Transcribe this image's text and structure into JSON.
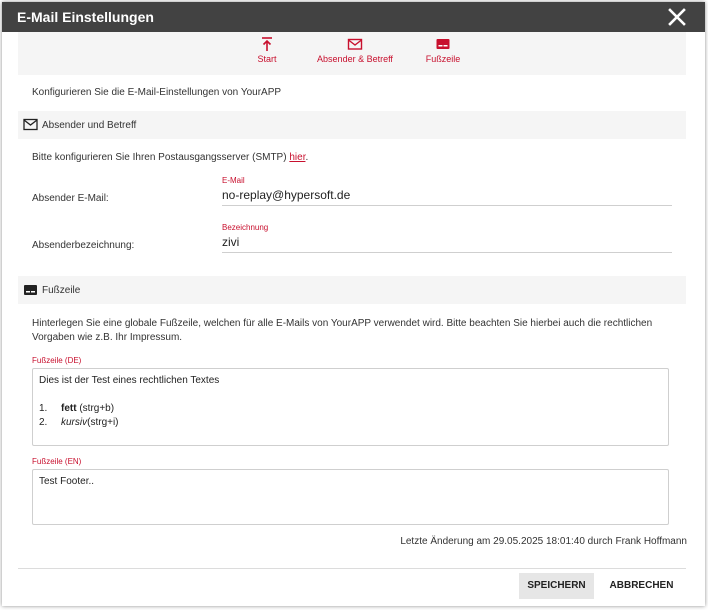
{
  "dialog": {
    "title": "E-Mail Einstellungen"
  },
  "nav": {
    "items": [
      {
        "label": "Start",
        "icon": "arrow-up-to-line-icon"
      },
      {
        "label": "Absender & Betreff",
        "icon": "envelope-icon"
      },
      {
        "label": "Fußzeile",
        "icon": "footer-icon"
      }
    ]
  },
  "intro": "Konfigurieren Sie die E-Mail-Einstellungen von YourAPP",
  "sender_section": {
    "heading": "Absender und Betreff",
    "smtp_text": "Bitte konfigurieren Sie Ihren Postausgangsserver (SMTP) ",
    "smtp_link": "hier",
    "smtp_end": ".",
    "email_row_label": "Absender E-Mail:",
    "email_field_label": "E-Mail",
    "email_value": "no-replay@hypersoft.de",
    "name_row_label": "Absenderbezeichnung:",
    "name_field_label": "Bezeichnung",
    "name_value": "zivi"
  },
  "footer_section": {
    "heading": "Fußzeile",
    "description": "Hinterlegen Sie eine globale Fußzeile, welchen für alle E-Mails von YourAPP verwendet wird. Bitte beachten Sie hierbei auch die rechtlichen Vorgaben wie z.B. Ihr Impressum.",
    "de_label": "Fußzeile (DE)",
    "de_line": "Dies ist der Test eines rechtlichen Textes",
    "de_list": [
      {
        "num": "1.",
        "styled": "fett",
        "rest": " (strg+b)"
      },
      {
        "num": "2.",
        "styled": "kursiv",
        "rest": "(strg+i)"
      }
    ],
    "en_label": "Fußzeile (EN)",
    "en_text": "Test Footer.."
  },
  "last_change": "Letzte Änderung am 29.05.2025 18:01:40 durch Frank Hoffmann",
  "buttons": {
    "save": "SPEICHERN",
    "cancel": "ABBRECHEN"
  },
  "colors": {
    "titlebar": "#424242",
    "accent": "#c8102e",
    "panel": "#f5f5f5"
  }
}
